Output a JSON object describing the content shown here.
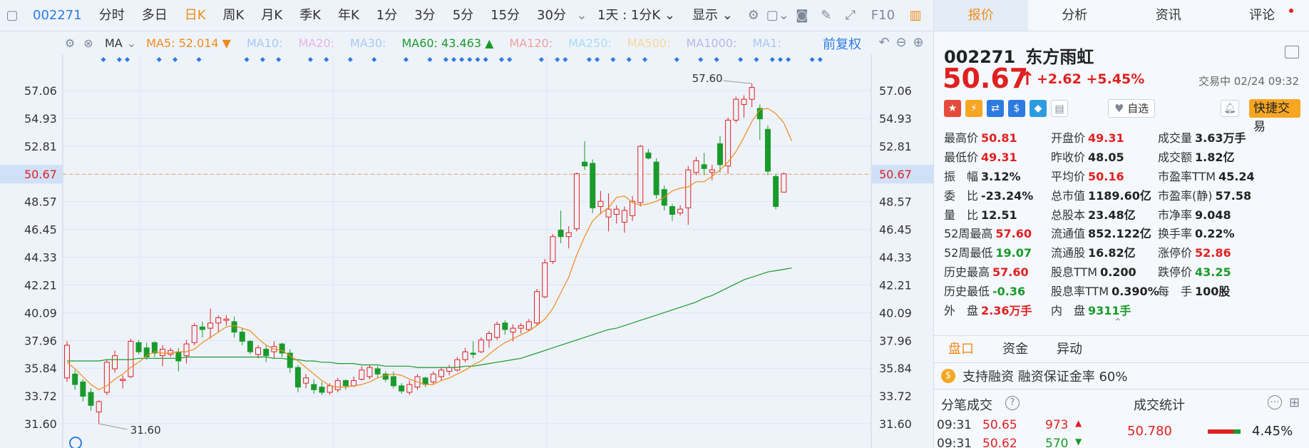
{
  "toolbar": {
    "code": "002271",
    "items": [
      "分时",
      "多日",
      "日K",
      "周K",
      "月K",
      "季K",
      "年K",
      "1分",
      "3分",
      "5分",
      "15分",
      "30分"
    ],
    "active_index": 2,
    "range": "1天 : 1分K",
    "display": "显示",
    "f10": "F10"
  },
  "ma_row": {
    "label": "MA",
    "items": [
      {
        "text": "MA5: 52.014 ▼",
        "color": "#f08b1a"
      },
      {
        "text": "MA10:",
        "color": "#a9c8f0"
      },
      {
        "text": "MA20:",
        "color": "#e6b3e6"
      },
      {
        "text": "MA30:",
        "color": "#a9c8f0"
      },
      {
        "text": "MA60: 43.463 ▲",
        "color": "#1a9a2a"
      },
      {
        "text": "MA120:",
        "color": "#f0a0a0"
      },
      {
        "text": "MA250:",
        "color": "#a8dcef"
      },
      {
        "text": "MA500:",
        "color": "#f3d79a"
      },
      {
        "text": "MA1000:",
        "color": "#b7b7e8"
      },
      {
        "text": "MA1:",
        "color": "#a9c8f0"
      }
    ],
    "adjust": "前复权"
  },
  "chart_data": {
    "type": "candlestick",
    "y_ticks": [
      "57.06",
      "54.93",
      "52.81",
      "50.67",
      "48.57",
      "46.45",
      "44.33",
      "42.21",
      "40.09",
      "37.96",
      "35.84",
      "33.72",
      "31.60"
    ],
    "ylim": [
      31.6,
      57.06
    ],
    "current_price": 50.67,
    "current_label": "50.67",
    "high_label": "57.60",
    "low_label": "31.60",
    "candles": [
      {
        "o": 35.1,
        "h": 37.9,
        "l": 34.8,
        "c": 37.6
      },
      {
        "o": 35.4,
        "h": 35.7,
        "l": 34.2,
        "c": 34.6
      },
      {
        "o": 34.8,
        "h": 35.0,
        "l": 33.3,
        "c": 33.7
      },
      {
        "o": 34.0,
        "h": 34.3,
        "l": 32.6,
        "c": 33.0
      },
      {
        "o": 32.5,
        "h": 33.4,
        "l": 31.6,
        "c": 33.3
      },
      {
        "o": 34.0,
        "h": 36.5,
        "l": 33.8,
        "c": 36.3
      },
      {
        "o": 35.8,
        "h": 37.2,
        "l": 35.5,
        "c": 36.8
      },
      {
        "o": 34.9,
        "h": 35.3,
        "l": 34.3,
        "c": 35.0
      },
      {
        "o": 35.2,
        "h": 38.1,
        "l": 35.1,
        "c": 37.9
      },
      {
        "o": 37.8,
        "h": 38.0,
        "l": 36.9,
        "c": 37.1
      },
      {
        "o": 37.4,
        "h": 37.8,
        "l": 36.5,
        "c": 36.7
      },
      {
        "o": 37.8,
        "h": 37.9,
        "l": 36.7,
        "c": 37.0
      },
      {
        "o": 36.8,
        "h": 37.6,
        "l": 36.0,
        "c": 37.3
      },
      {
        "o": 36.9,
        "h": 37.4,
        "l": 36.7,
        "c": 37.2
      },
      {
        "o": 37.1,
        "h": 37.4,
        "l": 35.6,
        "c": 36.4
      },
      {
        "o": 36.8,
        "h": 38.0,
        "l": 36.2,
        "c": 37.7
      },
      {
        "o": 37.8,
        "h": 39.3,
        "l": 37.6,
        "c": 39.1
      },
      {
        "o": 39.0,
        "h": 39.4,
        "l": 38.2,
        "c": 38.8
      },
      {
        "o": 38.9,
        "h": 40.4,
        "l": 38.1,
        "c": 39.3
      },
      {
        "o": 39.3,
        "h": 39.9,
        "l": 38.6,
        "c": 39.7
      },
      {
        "o": 39.5,
        "h": 39.9,
        "l": 39.1,
        "c": 39.6
      },
      {
        "o": 39.4,
        "h": 39.8,
        "l": 38.2,
        "c": 38.6
      },
      {
        "o": 38.6,
        "h": 38.9,
        "l": 37.6,
        "c": 37.9
      },
      {
        "o": 37.9,
        "h": 38.0,
        "l": 36.9,
        "c": 37.1
      },
      {
        "o": 36.9,
        "h": 37.6,
        "l": 36.6,
        "c": 37.4
      },
      {
        "o": 37.3,
        "h": 37.6,
        "l": 36.3,
        "c": 36.8
      },
      {
        "o": 37.1,
        "h": 37.9,
        "l": 36.6,
        "c": 37.5
      },
      {
        "o": 37.7,
        "h": 37.8,
        "l": 36.7,
        "c": 37.0
      },
      {
        "o": 37.0,
        "h": 37.3,
        "l": 35.5,
        "c": 35.9
      },
      {
        "o": 35.9,
        "h": 36.1,
        "l": 34.0,
        "c": 34.4
      },
      {
        "o": 34.7,
        "h": 35.4,
        "l": 34.3,
        "c": 35.1
      },
      {
        "o": 34.6,
        "h": 35.0,
        "l": 33.9,
        "c": 34.2
      },
      {
        "o": 34.4,
        "h": 34.8,
        "l": 33.8,
        "c": 34.0
      },
      {
        "o": 34.0,
        "h": 34.7,
        "l": 33.8,
        "c": 34.5
      },
      {
        "o": 34.2,
        "h": 35.1,
        "l": 34.0,
        "c": 34.9
      },
      {
        "o": 34.9,
        "h": 35.0,
        "l": 34.2,
        "c": 34.5
      },
      {
        "o": 34.5,
        "h": 35.2,
        "l": 34.4,
        "c": 34.9
      },
      {
        "o": 35.0,
        "h": 36.0,
        "l": 34.9,
        "c": 35.7
      },
      {
        "o": 35.2,
        "h": 36.1,
        "l": 35.0,
        "c": 35.9
      },
      {
        "o": 35.8,
        "h": 36.0,
        "l": 35.1,
        "c": 35.4
      },
      {
        "o": 35.4,
        "h": 35.6,
        "l": 34.8,
        "c": 35.0
      },
      {
        "o": 35.2,
        "h": 35.6,
        "l": 34.3,
        "c": 34.5
      },
      {
        "o": 34.5,
        "h": 34.7,
        "l": 33.9,
        "c": 34.1
      },
      {
        "o": 34.0,
        "h": 34.9,
        "l": 33.8,
        "c": 34.6
      },
      {
        "o": 34.4,
        "h": 35.4,
        "l": 34.2,
        "c": 35.2
      },
      {
        "o": 35.1,
        "h": 35.2,
        "l": 34.4,
        "c": 34.6
      },
      {
        "o": 34.8,
        "h": 35.6,
        "l": 34.6,
        "c": 35.4
      },
      {
        "o": 35.2,
        "h": 35.9,
        "l": 34.9,
        "c": 35.7
      },
      {
        "o": 35.6,
        "h": 36.1,
        "l": 35.3,
        "c": 35.9
      },
      {
        "o": 35.7,
        "h": 36.7,
        "l": 35.6,
        "c": 36.5
      },
      {
        "o": 36.5,
        "h": 37.4,
        "l": 36.3,
        "c": 37.1
      },
      {
        "o": 37.0,
        "h": 37.9,
        "l": 36.6,
        "c": 36.9
      },
      {
        "o": 37.1,
        "h": 38.2,
        "l": 37.0,
        "c": 38.0
      },
      {
        "o": 38.0,
        "h": 38.7,
        "l": 37.4,
        "c": 38.5
      },
      {
        "o": 38.2,
        "h": 39.4,
        "l": 38.0,
        "c": 39.2
      },
      {
        "o": 39.3,
        "h": 39.5,
        "l": 38.4,
        "c": 38.8
      },
      {
        "o": 38.6,
        "h": 39.2,
        "l": 37.9,
        "c": 38.9
      },
      {
        "o": 38.9,
        "h": 39.3,
        "l": 38.5,
        "c": 39.1
      },
      {
        "o": 38.8,
        "h": 39.6,
        "l": 38.7,
        "c": 39.4
      },
      {
        "o": 39.3,
        "h": 41.9,
        "l": 39.1,
        "c": 41.7
      },
      {
        "o": 41.3,
        "h": 44.2,
        "l": 41.2,
        "c": 43.9
      },
      {
        "o": 44.0,
        "h": 46.1,
        "l": 43.8,
        "c": 45.9
      },
      {
        "o": 46.4,
        "h": 47.9,
        "l": 45.4,
        "c": 45.9
      },
      {
        "o": 45.9,
        "h": 46.7,
        "l": 45.0,
        "c": 46.2
      },
      {
        "o": 46.5,
        "h": 50.8,
        "l": 46.3,
        "c": 50.7
      },
      {
        "o": 51.6,
        "h": 53.2,
        "l": 51.0,
        "c": 51.3
      },
      {
        "o": 51.5,
        "h": 51.8,
        "l": 47.7,
        "c": 48.1
      },
      {
        "o": 48.2,
        "h": 49.4,
        "l": 47.6,
        "c": 48.6
      },
      {
        "o": 47.4,
        "h": 49.2,
        "l": 46.3,
        "c": 48.0
      },
      {
        "o": 47.6,
        "h": 48.3,
        "l": 46.9,
        "c": 48.0
      },
      {
        "o": 47.0,
        "h": 48.2,
        "l": 46.2,
        "c": 47.9
      },
      {
        "o": 47.5,
        "h": 49.0,
        "l": 47.1,
        "c": 48.6
      },
      {
        "o": 48.5,
        "h": 52.9,
        "l": 48.2,
        "c": 52.8
      },
      {
        "o": 52.3,
        "h": 52.6,
        "l": 51.8,
        "c": 51.9
      },
      {
        "o": 51.6,
        "h": 51.9,
        "l": 48.8,
        "c": 49.1
      },
      {
        "o": 49.5,
        "h": 49.8,
        "l": 47.9,
        "c": 48.3
      },
      {
        "o": 48.2,
        "h": 48.4,
        "l": 47.1,
        "c": 47.6
      },
      {
        "o": 47.7,
        "h": 48.3,
        "l": 47.5,
        "c": 48.0
      },
      {
        "o": 48.1,
        "h": 51.3,
        "l": 46.8,
        "c": 51.0
      },
      {
        "o": 50.8,
        "h": 52.0,
        "l": 50.6,
        "c": 51.7
      },
      {
        "o": 51.4,
        "h": 52.3,
        "l": 50.6,
        "c": 51.1
      },
      {
        "o": 50.8,
        "h": 51.4,
        "l": 50.2,
        "c": 51.0
      },
      {
        "o": 53.0,
        "h": 53.6,
        "l": 50.8,
        "c": 51.4
      },
      {
        "o": 51.3,
        "h": 55.0,
        "l": 50.7,
        "c": 54.8
      },
      {
        "o": 54.8,
        "h": 56.6,
        "l": 54.6,
        "c": 56.4
      },
      {
        "o": 56.0,
        "h": 56.7,
        "l": 55.0,
        "c": 56.4
      },
      {
        "o": 56.4,
        "h": 57.6,
        "l": 55.8,
        "c": 57.3
      },
      {
        "o": 55.7,
        "h": 56.0,
        "l": 53.3,
        "c": 54.9
      },
      {
        "o": 54.1,
        "h": 54.4,
        "l": 50.6,
        "c": 50.9
      },
      {
        "o": 50.5,
        "h": 50.7,
        "l": 48.0,
        "c": 48.2
      },
      {
        "o": 49.3,
        "h": 50.8,
        "l": 49.3,
        "c": 50.7
      }
    ],
    "ma5": [
      36.3,
      35.8,
      35.2,
      34.6,
      34.2,
      34.5,
      35.0,
      35.4,
      35.9,
      36.3,
      36.8,
      37.1,
      37.0,
      37.0,
      37.1,
      37.1,
      37.3,
      37.8,
      38.2,
      38.6,
      39.0,
      39.1,
      38.9,
      38.7,
      38.1,
      37.6,
      37.3,
      37.2,
      36.8,
      36.4,
      35.9,
      35.4,
      34.9,
      34.5,
      34.4,
      34.4,
      34.5,
      34.6,
      34.8,
      35.1,
      35.3,
      35.4,
      35.3,
      35.0,
      34.8,
      34.6,
      34.6,
      34.9,
      35.1,
      35.4,
      35.7,
      36.1,
      36.4,
      36.9,
      37.4,
      37.8,
      38.1,
      38.4,
      38.7,
      39.1,
      39.6,
      40.4,
      41.6,
      42.8,
      44.5,
      45.9,
      47.1,
      47.7,
      48.1,
      48.9,
      49.0,
      48.5,
      48.3,
      48.4,
      48.6,
      48.9,
      49.4,
      49.6,
      49.7,
      50.1,
      50.1,
      50.5,
      51.0,
      51.6,
      52.4,
      53.5,
      54.7,
      55.6,
      55.7,
      55.3,
      54.6,
      53.2
    ],
    "ma60": [
      36.4,
      36.4,
      36.4,
      36.4,
      36.4,
      36.5,
      36.5,
      36.5,
      36.5,
      36.6,
      36.6,
      36.6,
      36.6,
      36.6,
      36.6,
      36.7,
      36.7,
      36.7,
      36.7,
      36.7,
      36.7,
      36.7,
      36.7,
      36.7,
      36.7,
      36.7,
      36.6,
      36.6,
      36.5,
      36.5,
      36.4,
      36.4,
      36.3,
      36.3,
      36.2,
      36.2,
      36.2,
      36.1,
      36.1,
      36.1,
      36.0,
      36.0,
      36.0,
      36.0,
      35.9,
      35.9,
      35.9,
      35.9,
      35.9,
      35.9,
      36.0,
      36.0,
      36.1,
      36.2,
      36.3,
      36.4,
      36.5,
      36.6,
      36.8,
      37.0,
      37.2,
      37.4,
      37.6,
      37.8,
      38.0,
      38.2,
      38.4,
      38.6,
      38.8,
      38.9,
      39.1,
      39.3,
      39.5,
      39.7,
      39.9,
      40.1,
      40.3,
      40.5,
      40.7,
      40.9,
      41.2,
      41.4,
      41.7,
      42.0,
      42.3,
      42.6,
      42.8,
      43.0,
      43.2,
      43.3,
      43.4,
      43.5
    ]
  },
  "panel": {
    "tabs": [
      "报价",
      "分析",
      "资讯",
      "评论"
    ],
    "code": "002271",
    "name": "东方雨虹",
    "price": "50.67",
    "arrow": "↑",
    "change": "+2.62",
    "change_pct": "+5.45%",
    "status": "交易中 02/24 09:32",
    "watch_label": "自选",
    "quick_trade": "快捷交易",
    "quote_rows": [
      [
        {
          "l": "最高价",
          "v": "50.81",
          "c": "up"
        },
        {
          "l": "开盘价",
          "v": "49.31",
          "c": "up"
        },
        {
          "l": "成交量",
          "v": "3.63万手",
          "c": "flat"
        }
      ],
      [
        {
          "l": "最低价",
          "v": "49.31",
          "c": "up"
        },
        {
          "l": "昨收价",
          "v": "48.05",
          "c": "flat"
        },
        {
          "l": "成交额",
          "v": "1.82亿",
          "c": "flat"
        }
      ],
      [
        {
          "l": "振　幅",
          "v": "3.12%",
          "c": "flat"
        },
        {
          "l": "平均价",
          "v": "50.16",
          "c": "up"
        },
        {
          "l": "市盈率TTM",
          "v": "45.24",
          "c": "flat"
        }
      ],
      [
        {
          "l": "委　比",
          "v": "-23.24%",
          "c": "flat"
        },
        {
          "l": "总市值",
          "v": "1189.60亿",
          "c": "flat"
        },
        {
          "l": "市盈率(静)",
          "v": "57.58",
          "c": "flat"
        }
      ],
      [
        {
          "l": "量　比",
          "v": "12.51",
          "c": "flat"
        },
        {
          "l": "总股本",
          "v": "23.48亿",
          "c": "flat"
        },
        {
          "l": "市净率",
          "v": "9.048",
          "c": "flat"
        }
      ],
      [
        {
          "l": "52周最高",
          "v": "57.60",
          "c": "up"
        },
        {
          "l": "流通值",
          "v": "852.122亿",
          "c": "flat"
        },
        {
          "l": "换手率",
          "v": "0.22%",
          "c": "flat"
        }
      ],
      [
        {
          "l": "52周最低",
          "v": "19.07",
          "c": "down"
        },
        {
          "l": "流通股",
          "v": "16.82亿",
          "c": "flat"
        },
        {
          "l": "涨停价",
          "v": "52.86",
          "c": "up"
        }
      ],
      [
        {
          "l": "历史最高",
          "v": "57.60",
          "c": "up"
        },
        {
          "l": "股息TTM",
          "v": "0.200",
          "c": "flat"
        },
        {
          "l": "跌停价",
          "v": "43.25",
          "c": "down"
        }
      ],
      [
        {
          "l": "历史最低",
          "v": "-0.36",
          "c": "down"
        },
        {
          "l": "股息率TTM",
          "v": "0.390%",
          "c": "flat"
        },
        {
          "l": "每　手",
          "v": "100股",
          "c": "flat"
        }
      ],
      [
        {
          "l": "外　盘",
          "v": "2.36万手",
          "c": "up"
        },
        {
          "l": "内　盘",
          "v": "9311手",
          "c": "down"
        }
      ]
    ],
    "sub_tabs": [
      "盘口",
      "资金",
      "异动"
    ],
    "margin_text": "支持融资 融资保证金率 60%",
    "ticks_title": "分笔成交",
    "stats_title": "成交统计",
    "ticks": [
      {
        "t": "09:31",
        "p": "50.65",
        "v": "973",
        "dir": "▲"
      },
      {
        "t": "09:31",
        "p": "50.62",
        "v": "570",
        "dir": "▼"
      }
    ],
    "stats_value": "50.780",
    "stats_pct": "4.45%"
  },
  "colors": {
    "up": "#e02020",
    "down": "#1a9a2a",
    "accent": "#f08b1a",
    "ma5": "#f08b1a",
    "ma60": "#1a9a2a",
    "blue": "#2d7be0"
  }
}
